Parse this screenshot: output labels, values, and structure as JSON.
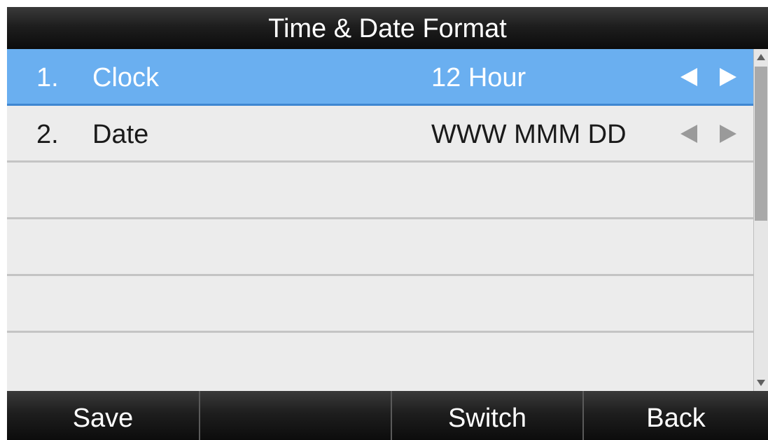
{
  "title": "Time & Date Format",
  "items": [
    {
      "number": "1.",
      "label": "Clock",
      "value": "12 Hour",
      "selected": true
    },
    {
      "number": "2.",
      "label": "Date",
      "value": "WWW MMM DD",
      "selected": false
    }
  ],
  "softkeys": {
    "key1": "Save",
    "key2": "",
    "key3": "Switch",
    "key4": "Back"
  },
  "icons": {
    "prev": "left-arrow-icon",
    "next": "right-arrow-icon",
    "scroll_up": "scroll-up-icon",
    "scroll_down": "scroll-down-icon"
  },
  "colors": {
    "selected_row": "#6aaff0",
    "title_bar": "#1e1e1e",
    "row_background": "#ececec"
  }
}
